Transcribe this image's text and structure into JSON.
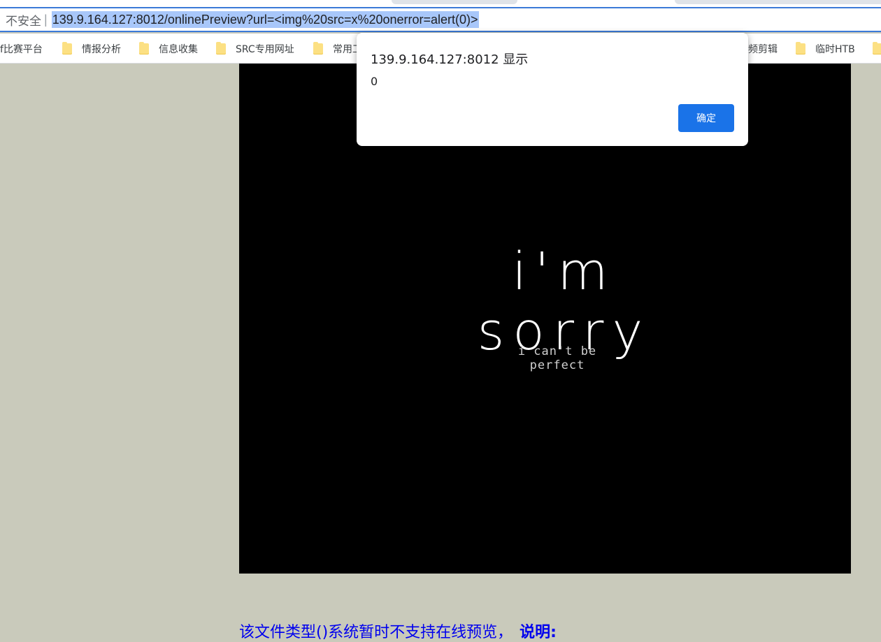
{
  "browser": {
    "security_label": "不安全",
    "url": "139.9.164.127:8012/onlinePreview?url=<img%20src=x%20onerror=alert(0)>"
  },
  "bookmarks": [
    {
      "label": "f比赛平台",
      "icon": "folder-icon",
      "has_icon": false
    },
    {
      "label": "情报分析",
      "icon": "folder-icon",
      "has_icon": true
    },
    {
      "label": "信息收集",
      "icon": "folder-icon",
      "has_icon": true
    },
    {
      "label": "SRC专用网址",
      "icon": "folder-icon",
      "has_icon": true
    },
    {
      "label": "常用工",
      "icon": "folder-icon",
      "has_icon": true
    },
    {
      "label": "频剪辑",
      "icon": "folder-icon",
      "has_icon": false
    },
    {
      "label": "临时HTB",
      "icon": "folder-icon",
      "has_icon": true
    }
  ],
  "preview": {
    "main_text": "i'm sorry",
    "sub_text": "i can't be perfect"
  },
  "alert": {
    "title": "139.9.164.127:8012 显示",
    "message": "0",
    "ok_label": "确定"
  },
  "footer": {
    "text": "该文件类型()系统暂时不支持在线预览，",
    "note_label": "说明:"
  }
}
